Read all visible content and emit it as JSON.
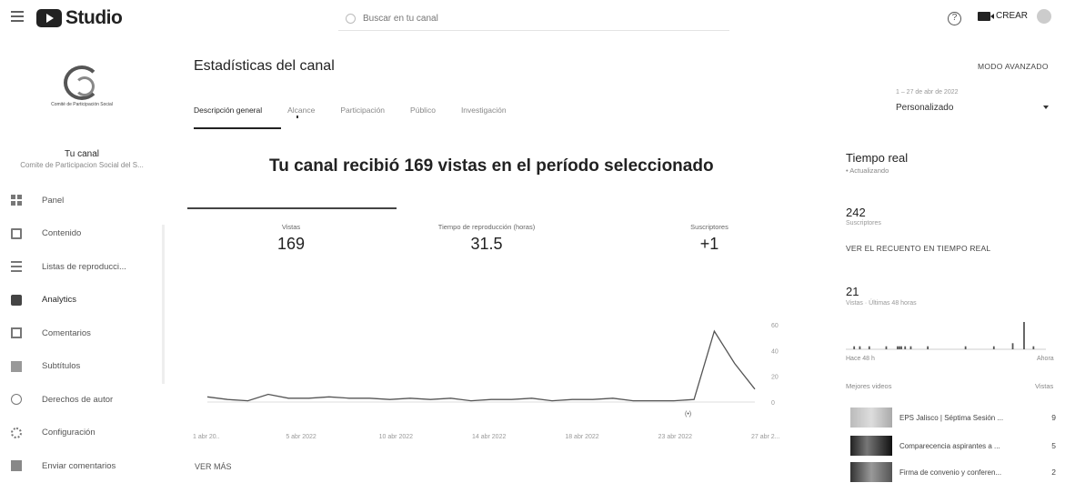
{
  "header": {
    "brand": "Studio",
    "search_placeholder": "Buscar en tu canal",
    "create_label": "CREAR",
    "help_glyph": "?"
  },
  "channel": {
    "logo_text": "Comité de Participación Social",
    "label": "Tu canal",
    "name": "Comite de Participacion Social del S..."
  },
  "sidebar": {
    "items": [
      {
        "label": "Panel",
        "icon": "dashboard-icon"
      },
      {
        "label": "Contenido",
        "icon": "content-icon"
      },
      {
        "label": "Listas de reproducci...",
        "icon": "playlist-icon"
      },
      {
        "label": "Analytics",
        "icon": "analytics-icon"
      },
      {
        "label": "Comentarios",
        "icon": "comments-icon"
      },
      {
        "label": "Subtítulos",
        "icon": "subtitles-icon"
      },
      {
        "label": "Derechos de autor",
        "icon": "copyright-icon"
      },
      {
        "label": "Configuración",
        "icon": "settings-icon"
      },
      {
        "label": "Enviar comentarios",
        "icon": "feedback-icon"
      }
    ]
  },
  "main": {
    "title": "Estadísticas del canal",
    "tabs": [
      "Descripción general",
      "Alcance",
      "Participación",
      "Público",
      "Investigación"
    ],
    "advanced_mode": "MODO AVANZADO",
    "date_range": "1 – 27 de abr de 2022",
    "period": "Personalizado",
    "headline": "Tu canal recibió 169 vistas en el período seleccionado",
    "metrics": [
      {
        "label": "Vistas",
        "value": "169"
      },
      {
        "label": "Tiempo de reproducción (horas)",
        "value": "31.5"
      },
      {
        "label": "Suscriptores",
        "value": "+1"
      }
    ],
    "see_more": "VER MÁS",
    "live_marker": "(•)"
  },
  "chart_data": {
    "type": "line",
    "x_labels": [
      "1 abr 20..",
      "5 abr 2022",
      "10 abr 2022",
      "14 abr 2022",
      "18 abr 2022",
      "23 abr 2022",
      "27 abr 2..."
    ],
    "y_ticks": [
      "60",
      "40",
      "20",
      "0"
    ],
    "ylim": [
      0,
      60
    ],
    "values": [
      4,
      2,
      1,
      6,
      3,
      3,
      4,
      3,
      3,
      2,
      3,
      2,
      3,
      1,
      2,
      2,
      3,
      1,
      2,
      2,
      3,
      1,
      1,
      1,
      2,
      55,
      30,
      10
    ]
  },
  "realtime": {
    "title": "Tiempo real",
    "status": "• Actualizando",
    "subs_value": "242",
    "subs_label": "Suscriptores",
    "link": "VER EL RECUENTO EN TIEMPO REAL",
    "views_value": "21",
    "views_label": "Vistas · Últimas 48 horas",
    "from_label": "Hace 48 h",
    "to_label": "Ahora",
    "top_videos_label": "Mejores videos",
    "views_col_label": "Vistas",
    "bars": [
      0,
      0,
      0,
      0,
      1,
      0,
      0,
      1,
      0,
      0,
      0,
      0,
      1,
      0,
      0,
      0,
      0,
      0,
      0,
      0,
      0,
      1,
      0,
      0,
      0,
      0,
      0,
      1,
      1,
      1,
      0,
      1,
      0,
      0,
      1,
      0,
      0,
      0,
      0,
      0,
      0,
      0,
      0,
      1,
      0,
      0,
      0,
      0,
      0,
      0,
      0,
      0,
      0,
      0,
      0,
      0,
      0,
      0,
      0,
      0,
      0,
      0,
      0,
      1,
      0,
      0,
      0,
      0,
      0,
      0,
      0,
      0,
      0,
      0,
      0,
      0,
      0,
      0,
      1,
      0,
      0,
      0,
      0,
      0,
      0,
      0,
      0,
      0,
      2,
      0,
      0,
      0,
      0,
      0,
      9,
      0,
      0,
      0,
      0,
      1,
      0,
      0,
      0,
      0,
      0,
      0
    ],
    "videos": [
      {
        "title": "EPS Jalisco | Séptima Sesión ...",
        "views": "9"
      },
      {
        "title": "Comparecencia aspirantes a ...",
        "views": "5"
      },
      {
        "title": "Firma de convenio y conferen...",
        "views": "2"
      }
    ]
  }
}
